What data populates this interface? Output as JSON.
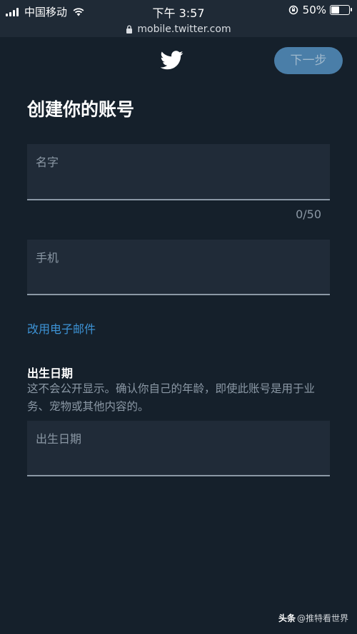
{
  "status_bar": {
    "carrier": "中国移动",
    "time": "下午 3:57",
    "battery": "50%",
    "battery_level": 0.5
  },
  "browser": {
    "url": "mobile.twitter.com"
  },
  "header": {
    "logo_icon": "twitter-bird-icon",
    "next_label": "下一步"
  },
  "form": {
    "title": "创建你的账号",
    "name_label": "名字",
    "name_counter": "0/50",
    "phone_label": "手机",
    "use_email_link": "改用电子邮件",
    "birthday_heading": "出生日期",
    "birthday_desc": "这不会公开显示。确认你自己的年龄，即使此账号是用于业务、宠物或其他内容的。",
    "birthday_label": "出生日期"
  },
  "watermark": {
    "brand": "头条",
    "handle": "@推特看世界"
  },
  "colors": {
    "background": "#15202b",
    "accent": "#3d93d6",
    "button": "#4a7ea8"
  }
}
